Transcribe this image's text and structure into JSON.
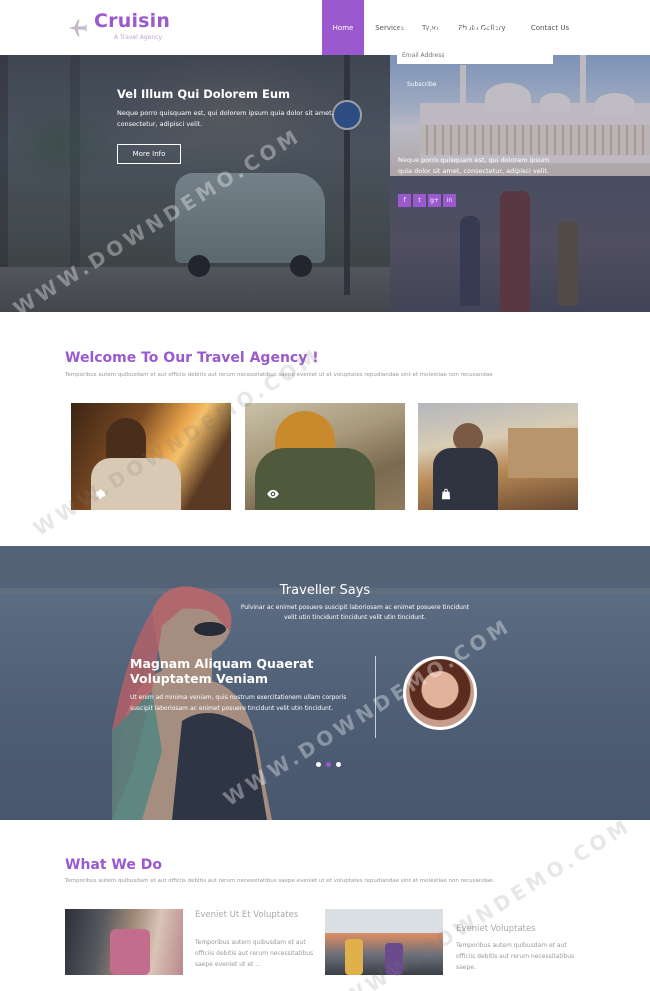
{
  "brand": {
    "name": "Cruisin",
    "tagline": "A Travel Agency",
    "accent": "#9b59d0"
  },
  "nav": {
    "items": [
      {
        "label": "Home",
        "active": true
      },
      {
        "label": "Services",
        "active": false
      },
      {
        "label": "Typo",
        "active": false
      },
      {
        "label": "Photo Gallery",
        "active": false
      },
      {
        "label": "Contact Us",
        "active": false
      }
    ]
  },
  "hero": {
    "title": "Vel Illum Qui Dolorem Eum",
    "text": "Neque porro quisquam est, qui dolorem ipsum quia dolor sit amet, consectetur, adipisci velit.",
    "button": "More Info"
  },
  "newsletter": {
    "title": "Newsletter",
    "placeholder": "Email Address",
    "subscribe": "Subscribe",
    "text": "Neque porro quisquam est, qui dolorem ipsum quia dolor sit amet, consectetur, adipisci velit.",
    "social": [
      "f",
      "t",
      "g+",
      "in"
    ]
  },
  "welcome": {
    "title": "Welcome To Our Travel Agency !",
    "subtitle": "Temporibus autem quibusdam et aut officiis debitis aut rerum necessitatibus saepe eveniet ut et voluptates repudiandae sint et molestiae non recusandae",
    "gallery": [
      {
        "icon": "gear-icon"
      },
      {
        "icon": "eye-icon"
      },
      {
        "icon": "bag-icon"
      }
    ]
  },
  "testimonial": {
    "title": "Traveller Says",
    "subtitle": "Pulvinar ac enimet posuere suscipit laboriosam ac enimet posuere tincidunt velit utin tincidunt tincidunt velit utin tincidunt.",
    "heading": "Magnam Aliquam Quaerat Voluptatem Veniam",
    "body": "Ut enim ad minima veniam, quis nostrum exercitationem ullam corporis suscipit laboriosam ac enimet posuere tincidunt velit utin tincidunt.",
    "dots": 3,
    "active_dot": 1
  },
  "what_we_do": {
    "title": "What We Do",
    "subtitle": "Temporibus autem quibusdam et aut officiis debitis aut rerum necessitatibus saepe eveniet ut et voluptates repudiandae sint et molestiae non recusandae.",
    "cards": [
      {
        "title": "Eveniet Ut Et Voluptates",
        "text": "Temporibus autem quibusdam et aut officiis debitis aut rerum necessitatibus saepe eveniet ut et ..."
      },
      {
        "title": "Eveniet Voluptates",
        "text": "Temporibus autem quibusdam et aut officiis debitis aut rerum necessitatibus saepe."
      }
    ]
  },
  "watermark": "WWW.DOWNDEMO.COM"
}
